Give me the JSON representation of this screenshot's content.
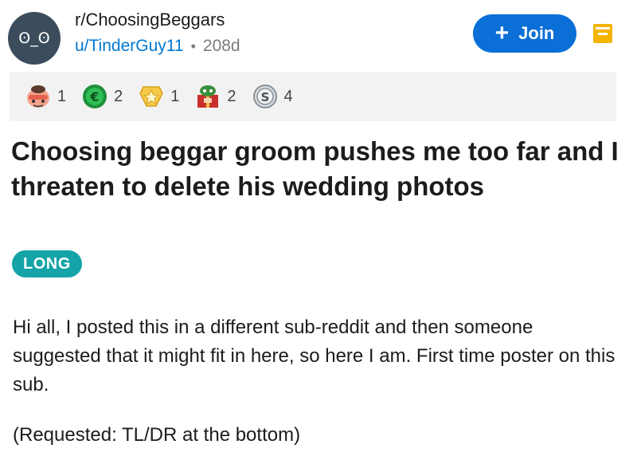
{
  "post_header": {
    "avatar_text": "ʘ_ʘ",
    "subreddit": "r/ChoosingBeggars",
    "author": "u/TinderGuy11",
    "separator": "•",
    "age": "208d",
    "join_label": "Join",
    "join_icon": "plus-icon",
    "menu_icon": "bookmark-icon"
  },
  "awards": [
    {
      "icon": "facepalm-award-icon",
      "count": "1"
    },
    {
      "icon": "coin-award-icon",
      "count": "2"
    },
    {
      "icon": "star-award-icon",
      "count": "1"
    },
    {
      "icon": "gift-character-award-icon",
      "count": "2"
    },
    {
      "icon": "silver-award-icon",
      "count": "4"
    }
  ],
  "post": {
    "title": "Choosing beggar groom pushes me too far and I threaten to delete his wedding photos",
    "flair": "LONG",
    "body_p1": "Hi all, I posted this in a different sub-reddit and then someone suggested that it might fit in here, so here I am. First time poster on this sub.",
    "body_p2": "(Requested: TL/DR at the bottom)"
  },
  "colors": {
    "join_button": "#0a6fd6",
    "author_link": "#0079d3",
    "flair_bg": "#14a3a7",
    "awards_bg": "#f2f2f2",
    "avatar_bg": "#3b4d5c",
    "bookmark": "#f5b400"
  }
}
